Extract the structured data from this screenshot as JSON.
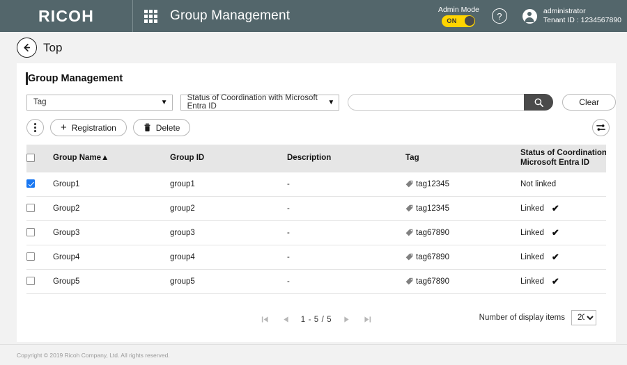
{
  "header": {
    "brand": "RICOH",
    "grid_icon": "apps-grid-icon",
    "title": "Group Management",
    "admin_mode_label": "Admin Mode",
    "admin_toggle_state": "ON",
    "help_icon": "question-mark-icon",
    "user_name": "administrator",
    "tenant_id": "Tenant ID : 1234567890",
    "accent_toggle_color": "#ffd400",
    "bar_color": "#53666b"
  },
  "breadcrumb": {
    "back_icon": "arrow-left-icon",
    "label": "Top"
  },
  "card": {
    "title": "Group Management"
  },
  "filters": {
    "tag_select_value": "Tag",
    "status_select_value": "Status of Coordination with Microsoft Entra ID",
    "search_value": "",
    "search_placeholder": "",
    "search_icon": "magnifier-icon",
    "clear_label": "Clear"
  },
  "toolbar": {
    "kebab_icon": "more-vertical-icon",
    "registration_label": "Registration",
    "registration_icon": "plus-icon",
    "delete_label": "Delete",
    "delete_icon": "trash-icon",
    "settings_icon": "sliders-icon"
  },
  "table": {
    "columns": [
      {
        "key": "check",
        "label": ""
      },
      {
        "key": "name",
        "label": "Group Name",
        "sort": "▲"
      },
      {
        "key": "id",
        "label": "Group ID"
      },
      {
        "key": "desc",
        "label": "Description"
      },
      {
        "key": "tag",
        "label": "Tag"
      },
      {
        "key": "status",
        "label_line1": "Status of Coordination wi",
        "label_line2": "Microsoft Entra ID"
      }
    ],
    "header_select_all_checked": false,
    "rows": [
      {
        "checked": true,
        "name": "Group1",
        "id": "group1",
        "desc": "-",
        "tag": "tag12345",
        "status": "Not linked",
        "linked": false
      },
      {
        "checked": false,
        "name": "Group2",
        "id": "group2",
        "desc": "-",
        "tag": "tag12345",
        "status": "Linked",
        "linked": true
      },
      {
        "checked": false,
        "name": "Group3",
        "id": "group3",
        "desc": "-",
        "tag": "tag67890",
        "status": "Linked",
        "linked": true
      },
      {
        "checked": false,
        "name": "Group4",
        "id": "group4",
        "desc": "-",
        "tag": "tag67890",
        "status": "Linked",
        "linked": true
      },
      {
        "checked": false,
        "name": "Group5",
        "id": "group5",
        "desc": "-",
        "tag": "tag67890",
        "status": "Linked",
        "linked": true
      }
    ]
  },
  "pagination": {
    "first_icon": "first-page-icon",
    "prev_icon": "prev-page-icon",
    "range_label": "1 - 5 / 5",
    "next_icon": "next-page-icon",
    "last_icon": "last-page-icon",
    "display_items_label": "Number of display items",
    "display_items_value": "20",
    "display_items_options": [
      "20"
    ]
  },
  "footer": {
    "copyright": "Copyright © 2019 Ricoh Company, Ltd. All rights reserved."
  }
}
